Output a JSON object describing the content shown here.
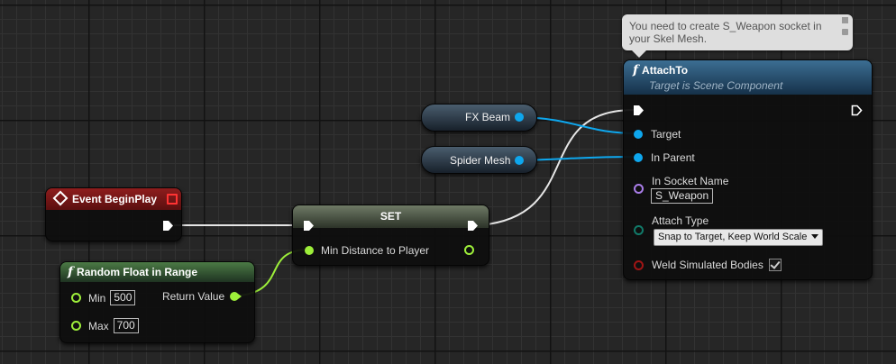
{
  "comment": {
    "text": "You need to create S_Weapon socket in your Skel Mesh."
  },
  "event_begin_play": {
    "title": "Event BeginPlay"
  },
  "random_float": {
    "title": "Random Float in Range",
    "min_label": "Min",
    "min_value": "500",
    "max_label": "Max",
    "max_value": "700",
    "return_label": "Return Value"
  },
  "set_node": {
    "title": "SET",
    "pin_label": "Min Distance to Player"
  },
  "variables": {
    "fx_beam": "FX Beam",
    "spider_mesh": "Spider Mesh"
  },
  "attach_to": {
    "title": "AttachTo",
    "subtitle": "Target is Scene Component",
    "target_label": "Target",
    "in_parent_label": "In Parent",
    "socket_label": "In Socket Name",
    "socket_value": "S_Weapon",
    "attach_type_label": "Attach Type",
    "attach_type_value": "Snap to Target, Keep World Scale",
    "weld_label": "Weld Simulated Bodies"
  },
  "colors": {
    "exec": "#ffffff",
    "object": "#0ea7ee",
    "float": "#9dee3a",
    "name": "#a97de8",
    "enum": "#117b6a",
    "bool": "#a11515"
  }
}
